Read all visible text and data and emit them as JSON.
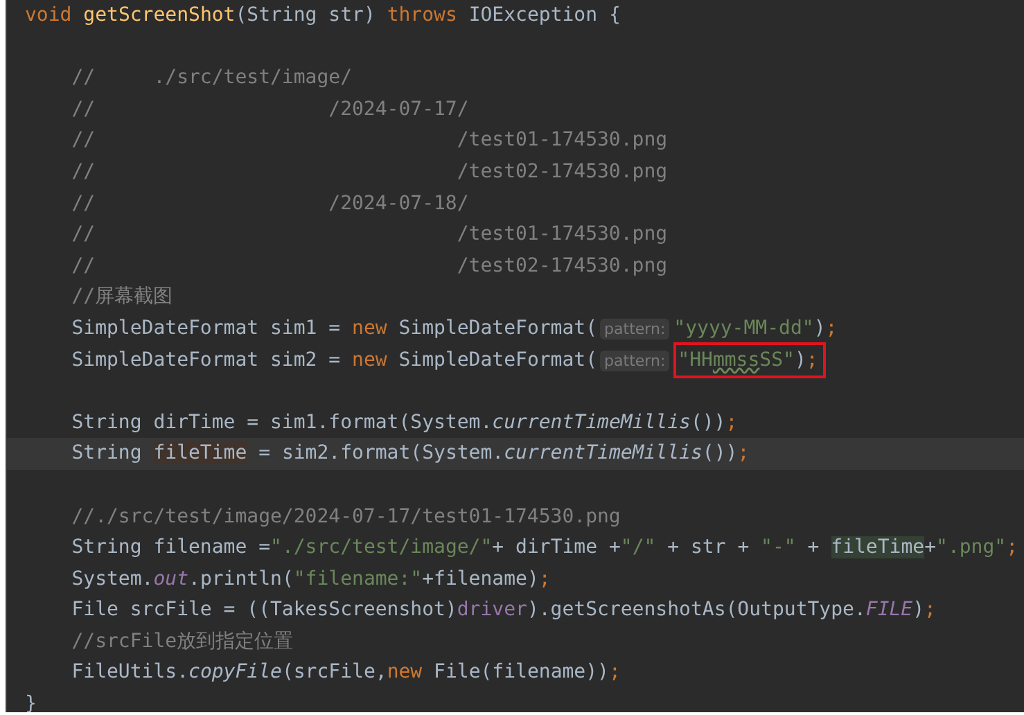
{
  "editor": {
    "lines": [
      {
        "kind": "code",
        "current": false,
        "runs": [
          {
            "kind": "keyword",
            "text": "void "
          },
          {
            "kind": "declaration",
            "text": "getScreenShot"
          },
          {
            "kind": "plain",
            "text": "(String str) "
          },
          {
            "kind": "keyword",
            "text": "throws "
          },
          {
            "kind": "plain",
            "text": "IOException {"
          }
        ]
      },
      {
        "kind": "blank",
        "current": false
      },
      {
        "kind": "code",
        "current": false,
        "runs": [
          {
            "kind": "comment",
            "text": "    //     ./src/test/image/"
          }
        ]
      },
      {
        "kind": "code",
        "current": false,
        "runs": [
          {
            "kind": "comment",
            "text": "    //                    /2024-07-17/"
          }
        ]
      },
      {
        "kind": "code",
        "current": false,
        "runs": [
          {
            "kind": "comment",
            "text": "    //                               /test01-174530.png"
          }
        ]
      },
      {
        "kind": "code",
        "current": false,
        "runs": [
          {
            "kind": "comment",
            "text": "    //                               /test02-174530.png"
          }
        ]
      },
      {
        "kind": "code",
        "current": false,
        "runs": [
          {
            "kind": "comment",
            "text": "    //                    /2024-07-18/"
          }
        ]
      },
      {
        "kind": "code",
        "current": false,
        "runs": [
          {
            "kind": "comment",
            "text": "    //                               /test01-174530.png"
          }
        ]
      },
      {
        "kind": "code",
        "current": false,
        "runs": [
          {
            "kind": "comment",
            "text": "    //                               /test02-174530.png"
          }
        ]
      },
      {
        "kind": "code",
        "current": false,
        "runs": [
          {
            "kind": "comment",
            "text": "    //屏幕截图"
          }
        ]
      },
      {
        "kind": "code",
        "current": false,
        "runs": [
          {
            "kind": "plain",
            "text": "    SimpleDateFormat sim1 = "
          },
          {
            "kind": "keyword",
            "text": "new "
          },
          {
            "kind": "plain",
            "text": "SimpleDateFormat("
          },
          {
            "kind": "hint",
            "text": "pattern:"
          },
          {
            "kind": "string",
            "text": "\"yyyy-MM-dd\""
          },
          {
            "kind": "plain",
            "text": ")"
          },
          {
            "kind": "keyword",
            "text": ";"
          }
        ]
      },
      {
        "kind": "code",
        "current": false,
        "runs": [
          {
            "kind": "plain",
            "text": "    SimpleDateFormat sim2 = "
          },
          {
            "kind": "keyword",
            "text": "new "
          },
          {
            "kind": "plain",
            "text": "SimpleDateFormat("
          },
          {
            "kind": "hint",
            "text": "pattern:"
          },
          {
            "kind": "string",
            "text": "\"HH",
            "boxed": true
          },
          {
            "kind": "typo",
            "text": "mmss",
            "boxed": true
          },
          {
            "kind": "string",
            "text": "SS\"",
            "boxed": true
          },
          {
            "kind": "plain",
            "text": ")",
            "boxed": true
          },
          {
            "kind": "keyword",
            "text": ";",
            "boxed": true
          }
        ]
      },
      {
        "kind": "blank",
        "current": false
      },
      {
        "kind": "code",
        "current": false,
        "runs": [
          {
            "kind": "plain",
            "text": "    String dirTime = sim1.format(System."
          },
          {
            "kind": "static-method",
            "text": "currentTimeMillis"
          },
          {
            "kind": "plain",
            "text": "())"
          },
          {
            "kind": "keyword",
            "text": ";"
          }
        ]
      },
      {
        "kind": "code",
        "current": true,
        "runs": [
          {
            "kind": "plain",
            "text": "    String "
          },
          {
            "kind": "write-highlight",
            "text": "fileTime"
          },
          {
            "kind": "plain",
            "text": " = sim2.format(System."
          },
          {
            "kind": "static-method",
            "text": "currentTimeMillis"
          },
          {
            "kind": "plain",
            "text": "())"
          },
          {
            "kind": "keyword",
            "text": ";"
          }
        ]
      },
      {
        "kind": "blank",
        "current": false
      },
      {
        "kind": "code",
        "current": false,
        "runs": [
          {
            "kind": "comment",
            "text": "    //./src/test/image/2024-07-17/test01-174530.png"
          }
        ]
      },
      {
        "kind": "code",
        "current": false,
        "runs": [
          {
            "kind": "plain",
            "text": "    String filename ="
          },
          {
            "kind": "string",
            "text": "\"./src/test/image/\""
          },
          {
            "kind": "plain",
            "text": "+ dirTime +"
          },
          {
            "kind": "string",
            "text": "\"/\""
          },
          {
            "kind": "plain",
            "text": " + str + "
          },
          {
            "kind": "string",
            "text": "\"-\""
          },
          {
            "kind": "plain",
            "text": " + "
          },
          {
            "kind": "read-highlight",
            "text": "fileTime"
          },
          {
            "kind": "plain",
            "text": "+"
          },
          {
            "kind": "string",
            "text": "\".png\""
          },
          {
            "kind": "keyword",
            "text": ";"
          }
        ]
      },
      {
        "kind": "code",
        "current": false,
        "runs": [
          {
            "kind": "plain",
            "text": "    System."
          },
          {
            "kind": "static-field",
            "text": "out"
          },
          {
            "kind": "plain",
            "text": ".println("
          },
          {
            "kind": "string",
            "text": "\"filename:\""
          },
          {
            "kind": "plain",
            "text": "+filename)"
          },
          {
            "kind": "keyword",
            "text": ";"
          }
        ]
      },
      {
        "kind": "code",
        "current": false,
        "runs": [
          {
            "kind": "plain",
            "text": "    File srcFile = ((TakesScreenshot)"
          },
          {
            "kind": "field",
            "text": "driver"
          },
          {
            "kind": "plain",
            "text": ").getScreenshotAs(OutputType."
          },
          {
            "kind": "static-field",
            "text": "FILE"
          },
          {
            "kind": "plain",
            "text": ")"
          },
          {
            "kind": "keyword",
            "text": ";"
          }
        ]
      },
      {
        "kind": "code",
        "current": false,
        "runs": [
          {
            "kind": "comment",
            "text": "    //srcFile放到指定位置"
          }
        ]
      },
      {
        "kind": "code",
        "current": false,
        "runs": [
          {
            "kind": "plain",
            "text": "    FileUtils."
          },
          {
            "kind": "static-method",
            "text": "copyFile"
          },
          {
            "kind": "plain",
            "text": "(srcFile,"
          },
          {
            "kind": "keyword",
            "text": "new "
          },
          {
            "kind": "plain",
            "text": "File(filename))"
          },
          {
            "kind": "keyword",
            "text": ";"
          }
        ]
      },
      {
        "kind": "code",
        "current": false,
        "runs": [
          {
            "kind": "plain",
            "text": "}"
          }
        ]
      }
    ]
  }
}
